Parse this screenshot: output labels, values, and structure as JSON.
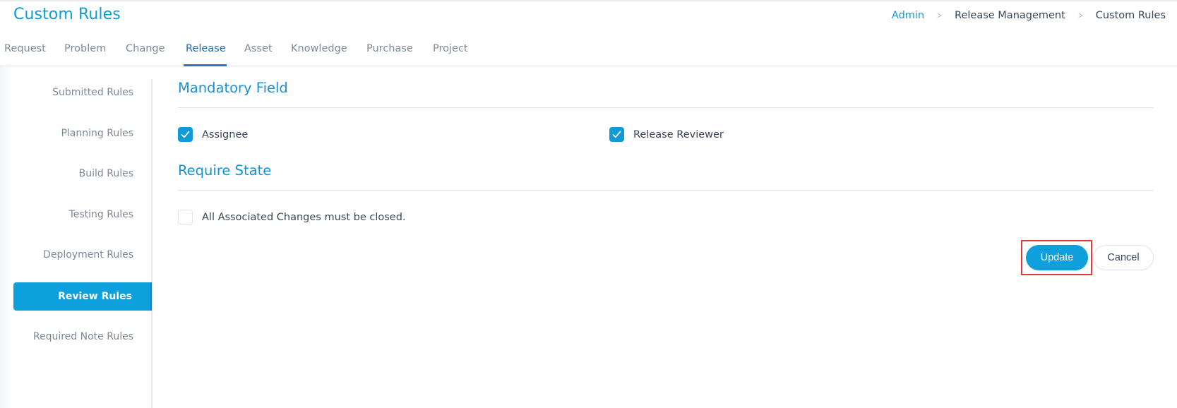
{
  "header": {
    "title": "Custom Rules",
    "breadcrumb": [
      {
        "label": "Admin",
        "link": true
      },
      {
        "label": "Release Management",
        "link": false
      },
      {
        "label": "Custom Rules",
        "link": false
      }
    ],
    "breadcrumb_separator": ">"
  },
  "tabs": [
    {
      "label": "Request",
      "active": false
    },
    {
      "label": "Problem",
      "active": false
    },
    {
      "label": "Change",
      "active": false
    },
    {
      "label": "Release",
      "active": true
    },
    {
      "label": "Asset",
      "active": false
    },
    {
      "label": "Knowledge",
      "active": false
    },
    {
      "label": "Purchase",
      "active": false
    },
    {
      "label": "Project",
      "active": false
    }
  ],
  "sidebar": {
    "items": [
      {
        "label": "Submitted Rules",
        "active": false
      },
      {
        "label": "Planning Rules",
        "active": false
      },
      {
        "label": "Build Rules",
        "active": false
      },
      {
        "label": "Testing Rules",
        "active": false
      },
      {
        "label": "Deployment Rules",
        "active": false
      },
      {
        "label": "Review Rules",
        "active": true
      },
      {
        "label": "Required Note Rules",
        "active": false
      }
    ]
  },
  "main": {
    "mandatory_field": {
      "title": "Mandatory Field",
      "options": [
        {
          "label": "Assignee",
          "checked": true
        },
        {
          "label": "Release Reviewer",
          "checked": true
        }
      ]
    },
    "require_state": {
      "title": "Require State",
      "options": [
        {
          "label": "All Associated Changes must be closed.",
          "checked": false
        }
      ]
    },
    "actions": {
      "update_label": "Update",
      "cancel_label": "Cancel"
    }
  },
  "colors": {
    "accent": "#0ea0dd",
    "title": "#1593d2",
    "active_tab": "#1f6bb7",
    "highlight": "#e23b3b"
  }
}
